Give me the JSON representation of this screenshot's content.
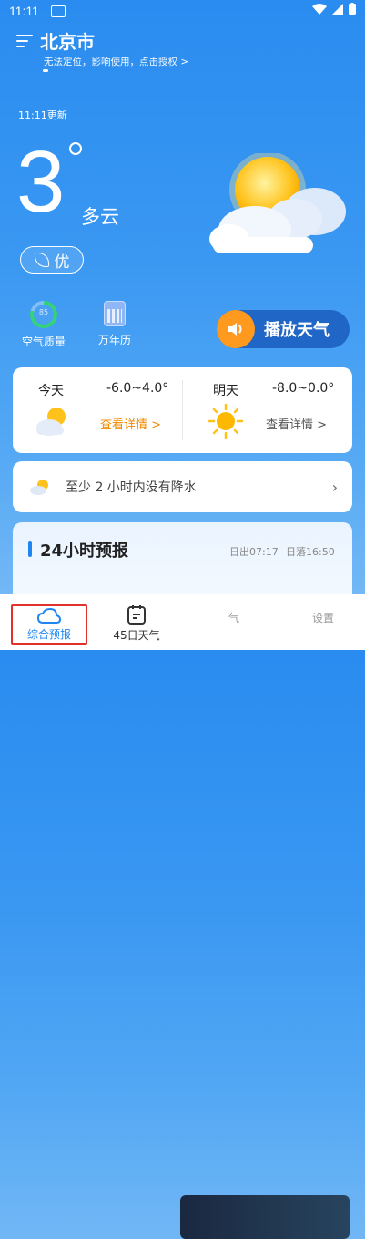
{
  "status_bar": {
    "time": "11:11"
  },
  "header": {
    "city": "北京市",
    "location_hint": "无法定位，影响使用，点击授权 >"
  },
  "weather": {
    "updated": "11:11更新",
    "temperature": "3",
    "condition": "多云",
    "air_quality": "优"
  },
  "quick_links": [
    {
      "label": "空气质量",
      "ring_value": "85"
    },
    {
      "label": "万年历"
    }
  ],
  "play_button": {
    "label": "播放天气"
  },
  "today": {
    "label": "今天",
    "range": "-6.0~4.0°",
    "detail": "查看详情 >"
  },
  "tomorrow": {
    "label": "明天",
    "range": "-8.0~0.0°",
    "detail": "查看详情 >"
  },
  "rain_notice": {
    "text": "至少 2 小时内没有降水"
  },
  "forecast_24h": {
    "title": "24小时预报",
    "sunrise": "日出07:17",
    "sunset": "日落16:50"
  },
  "bottom_nav": [
    {
      "label": "综合预报",
      "active": true
    },
    {
      "label": "45日天气"
    },
    {
      "label": "气"
    },
    {
      "label": "设置"
    }
  ],
  "colors": {
    "accent_orange": "#ff9a1f",
    "play_bg": "#1f66c7",
    "active_nav": "#1e86f0"
  }
}
